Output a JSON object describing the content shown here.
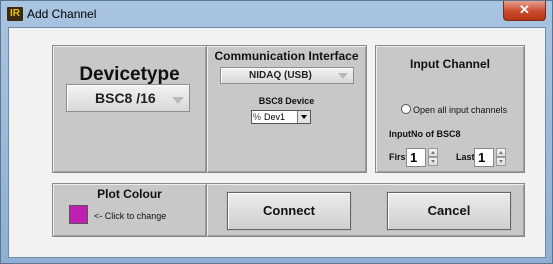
{
  "window": {
    "title": "Add Channel",
    "icon_text": "IR",
    "close_symbol": "✕"
  },
  "device_panel": {
    "heading": "Devicetype",
    "device_type_value": "BSC8 /16"
  },
  "comm_panel": {
    "heading": "Communication Interface",
    "interface_value": "NIDAQ (USB)",
    "bsc8_device_label": "BSC8 Device",
    "bsc8_device_value": "Dev1",
    "io_icon": "%"
  },
  "input_panel": {
    "heading": "Input Channel",
    "open_all_label": "Open all input channels",
    "inputno_label": "InputNo of BSC8",
    "first_label": "First",
    "first_value": "1",
    "last_label": "Last",
    "last_value": "1"
  },
  "plot_panel": {
    "heading": "Plot Colour",
    "hint": "<- Click to change",
    "swatch_color": "#c020b0"
  },
  "buttons": {
    "connect": "Connect",
    "cancel": "Cancel"
  }
}
